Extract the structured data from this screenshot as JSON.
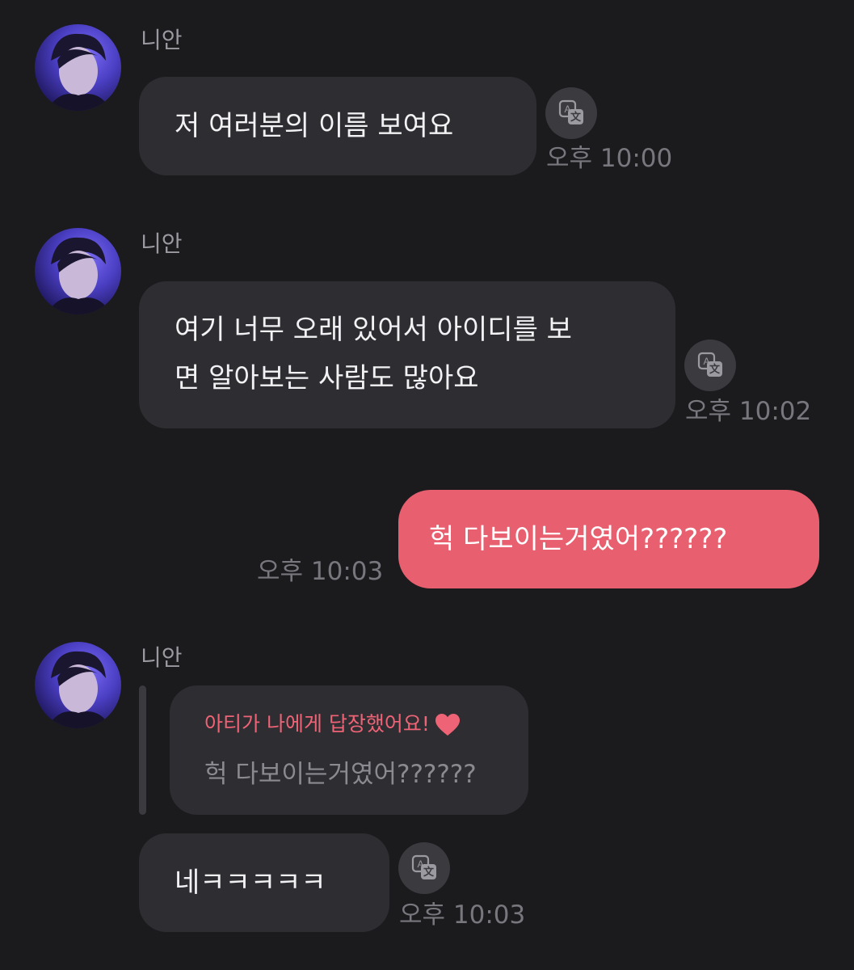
{
  "messages": [
    {
      "sender": "니안",
      "text_lines": [
        "저 여러분의 이름 보여요"
      ],
      "time": "오후 10:00"
    },
    {
      "sender": "니안",
      "text_lines": [
        "여기 너무 오래 있어서 아이디를 보",
        "면 알아보는 사람도 많아요"
      ],
      "time": "오후 10:02"
    },
    {
      "text": "헉 다보이는거였어??????",
      "time": "오후 10:03"
    },
    {
      "sender": "니안",
      "reply_header": "아티가 나에게 답장했어요!",
      "quoted_text": "헉 다보이는거였어??????",
      "text": "네ㅋㅋㅋㅋㅋ",
      "time": "오후 10:03"
    }
  ],
  "colors": {
    "background": "#1b1b1e",
    "incoming_bubble": "#2e2e32",
    "outgoing_bubble": "#e8606f",
    "reply_accent": "#ef6376",
    "timestamp": "#77777d"
  },
  "icons": {
    "translate": "translate-icon",
    "heart": "heart-icon"
  }
}
